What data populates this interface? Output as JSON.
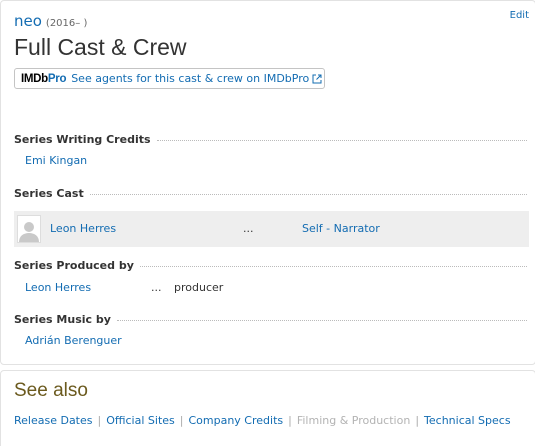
{
  "header": {
    "edit_label": "Edit",
    "show_title": "neo",
    "show_years": "(2016– )",
    "page_title": "Full Cast & Crew"
  },
  "imdbpro": {
    "logo_imdb": "IMDb",
    "logo_pro": "Pro",
    "link_text": "See agents for this cast & crew on IMDbPro"
  },
  "sections": {
    "writing": {
      "heading": "Series Writing Credits",
      "names": [
        "Emi Kingan"
      ]
    },
    "cast": {
      "heading": "Series Cast",
      "rows": [
        {
          "name": "Leon Herres",
          "dots": "...",
          "character": "Self - Narrator"
        }
      ]
    },
    "produced": {
      "heading": "Series Produced by",
      "rows": [
        {
          "name": "Leon Herres",
          "dots": "...",
          "role": "producer"
        }
      ]
    },
    "music": {
      "heading": "Series Music by",
      "names": [
        "Adrián Berenguer"
      ]
    }
  },
  "see_also": {
    "title": "See also",
    "links": [
      {
        "label": "Release Dates",
        "enabled": true
      },
      {
        "label": "Official Sites",
        "enabled": true
      },
      {
        "label": "Company Credits",
        "enabled": true
      },
      {
        "label": "Filming & Production",
        "enabled": false
      },
      {
        "label": "Technical Specs",
        "enabled": true
      }
    ],
    "separator": "|"
  },
  "colors": {
    "link": "#136cb2",
    "see_also_title": "#6b5a1e",
    "row_highlight": "#eeeeee",
    "disabled_link": "#b3b3b3"
  }
}
